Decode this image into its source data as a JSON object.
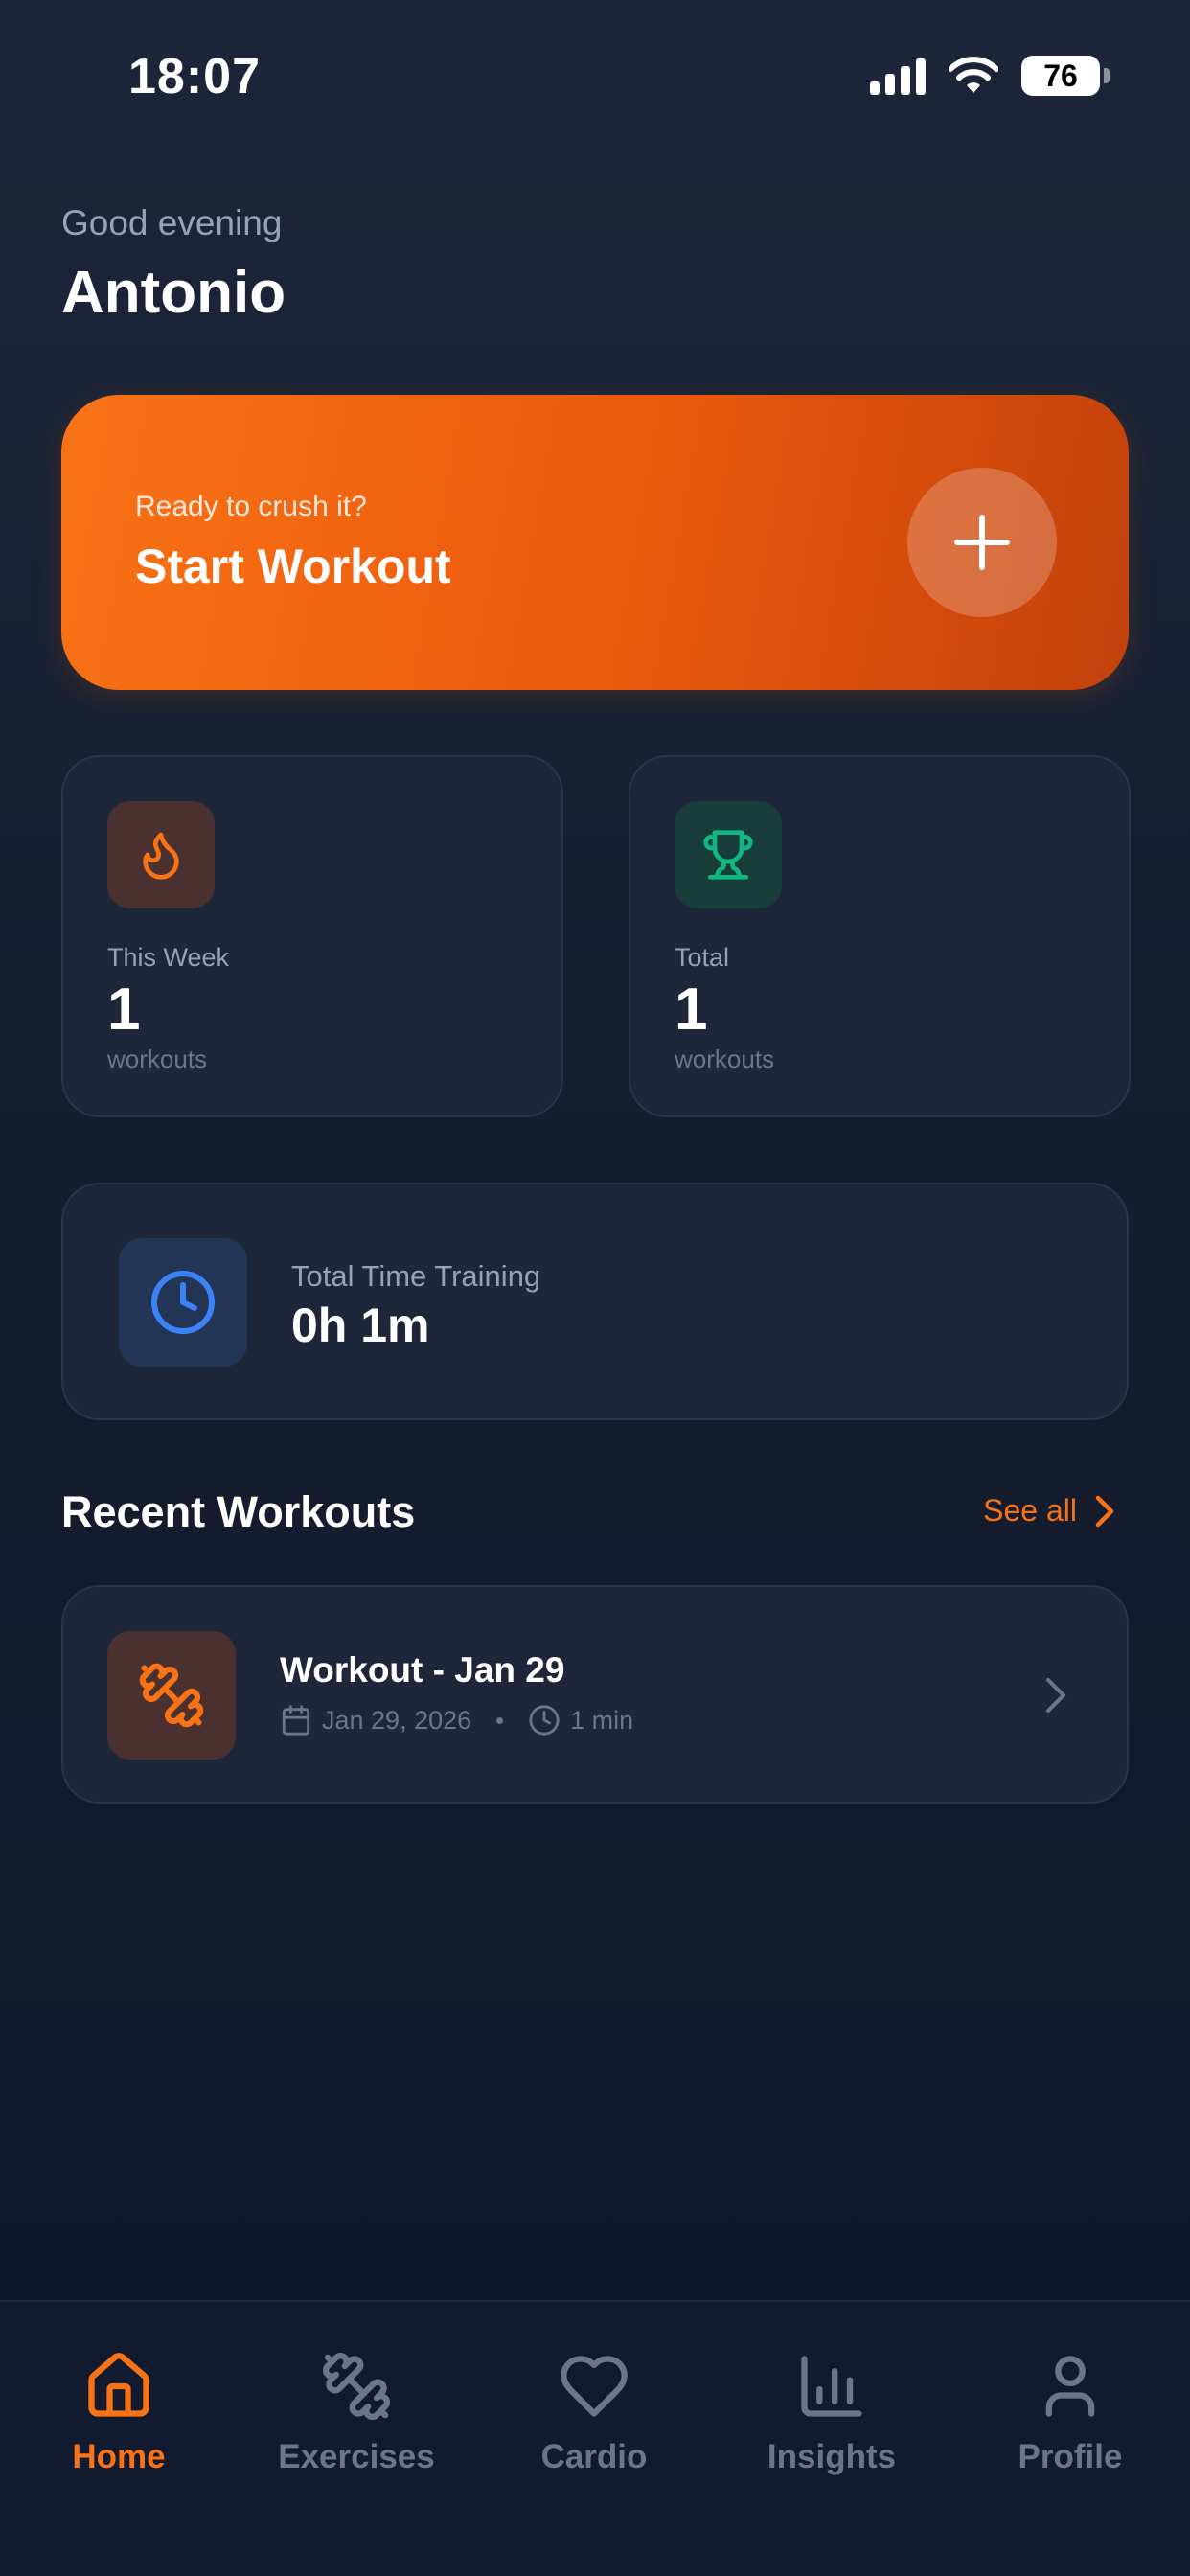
{
  "status_bar": {
    "time": "18:07",
    "battery": "76"
  },
  "header": {
    "greeting": "Good evening",
    "name": "Antonio"
  },
  "start_card": {
    "subtitle": "Ready to crush it?",
    "title": "Start Workout"
  },
  "stats": [
    {
      "label": "This Week",
      "value": "1",
      "unit": "workouts",
      "icon": "fire-icon",
      "color": "#f97316"
    },
    {
      "label": "Total",
      "value": "1",
      "unit": "workouts",
      "icon": "trophy-icon",
      "color": "#10b981"
    }
  ],
  "time_training": {
    "label": "Total Time Training",
    "value": "0h 1m",
    "icon": "clock-icon",
    "color": "#3b82f6"
  },
  "recent": {
    "title": "Recent Workouts",
    "see_all": "See all",
    "items": [
      {
        "name": "Workout - Jan 29",
        "date": "Jan 29, 2026",
        "duration": "1 min",
        "icon": "dumbbell-icon"
      }
    ]
  },
  "nav": {
    "items": [
      {
        "label": "Home",
        "icon": "home-icon",
        "active": true
      },
      {
        "label": "Exercises",
        "icon": "dumbbell-icon",
        "active": false
      },
      {
        "label": "Cardio",
        "icon": "heart-icon",
        "active": false
      },
      {
        "label": "Insights",
        "icon": "bar-chart-icon",
        "active": false
      },
      {
        "label": "Profile",
        "icon": "person-icon",
        "active": false
      }
    ]
  },
  "colors": {
    "accent": "#f97316",
    "background": "#0f172a",
    "card": "#1e2739",
    "muted": "#94a3b8"
  }
}
